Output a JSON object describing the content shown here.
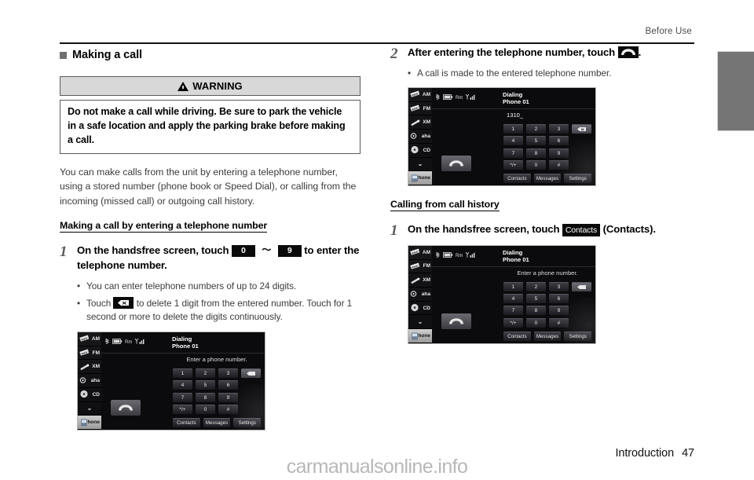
{
  "header": {
    "running_head": "Before Use"
  },
  "footer": {
    "section": "Introduction",
    "page_number": "47",
    "watermark": "carmanualsonline.info"
  },
  "left_column": {
    "section_heading": "Making a call",
    "warning": {
      "title": "WARNING",
      "body": "Do not make a call while driving. Be sure to park the vehicle in a safe location and apply the parking brake before making a call."
    },
    "intro_paragraph": "You can make calls from the unit by entering a telephone number, using a stored number (phone book or Speed Dial), or calling from the incoming (missed call) or outgoing call history.",
    "sub_heading": "Making a call by entering a telephone number",
    "step1": {
      "number": "1",
      "text_before": "On the handsfree screen, touch",
      "key_from": "0",
      "range_symbol": "〜",
      "key_to": "9",
      "text_after": "to enter the telephone number.",
      "bullets": [
        "You can enter telephone numbers of up to 24 digits.",
        "Touch to delete 1 digit from the entered number. Touch for 1 second or more to delete the digits continuously."
      ],
      "bullet2_before": "Touch",
      "bullet2_after": "to delete 1 digit from the entered number. Touch for 1 second or more to delete the digits continuously."
    }
  },
  "right_column": {
    "step2": {
      "number": "2",
      "text_before": "After entering the telephone number, touch",
      "text_after": ".",
      "bullet": "A call is made to the entered telephone number."
    },
    "sub_heading": "Calling from call history",
    "step1": {
      "number": "1",
      "text_before": "On the handsfree screen, touch",
      "button_label": "Contacts",
      "text_after": "(Contacts)."
    }
  },
  "device_screens": {
    "sources": [
      "AM",
      "FM",
      "XM",
      "aha",
      "CD",
      "⌄",
      "Phone"
    ],
    "status": {
      "roaming": "Rm"
    },
    "title_line1": "Dialing",
    "title_line2": "Phone 01",
    "prompt_empty": "Enter a phone number.",
    "prompt_dialed": "1310_",
    "keys": [
      [
        "1",
        "2",
        "3"
      ],
      [
        "4",
        "5",
        "6"
      ],
      [
        "7",
        "8",
        "9"
      ],
      [
        "*/+",
        "0",
        "#"
      ]
    ],
    "delete_key": "delete-icon",
    "bottom_tabs": [
      "Contacts",
      "Messages",
      "Settings"
    ],
    "call_icon": "handset-icon"
  },
  "colors": {
    "rule": "#111111",
    "warn_header_bg": "#d8d8d8",
    "edge_tab": "#757575",
    "body_text": "#3c3c3c"
  }
}
